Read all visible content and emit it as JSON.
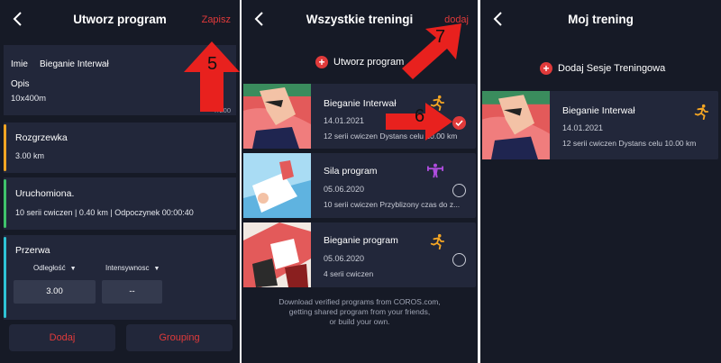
{
  "colors": {
    "accent": "#e03a3a",
    "background": "#161a26",
    "card": "#22273a",
    "warmup": "#f5a623",
    "run": "#3fc36b",
    "rest": "#2ec4d6",
    "strength": "#b04de0",
    "run_icon": "#f5a623"
  },
  "screen1": {
    "title": "Utworz program",
    "save": "Zapisz",
    "name_label": "Imie",
    "name_value": "Bieganie Interwał",
    "desc_label": "Opis",
    "desc_value": "10x400m",
    "char_count": "7/200",
    "segments": [
      {
        "title": "Rozgrzewka",
        "detail": "3.00 km"
      },
      {
        "title": "Uruchomiona.",
        "detail": "10 serii cwiczen | 0.40 km | Odpoczynek 00:00:40"
      },
      {
        "title": "Przerwa",
        "detail": ""
      }
    ],
    "dropdown_distance": "Odległość",
    "dropdown_intensity": "Intensywnosc",
    "distance_value": "3.00",
    "intensity_value": "--",
    "btn_add": "Dodaj",
    "btn_grouping": "Grouping",
    "marker": "5"
  },
  "screen2": {
    "title": "Wszystkie treningi",
    "add": "dodaj",
    "create": "Utworz program",
    "marker_check": "6",
    "marker_add": "7",
    "programs": [
      {
        "name": "Bieganie Interwał",
        "date": "14.01.2021",
        "desc": "12 serii cwiczen Dystans celu 10.00 km",
        "icon": "runner-icon",
        "selected": true
      },
      {
        "name": "Sila program",
        "date": "05.06.2020",
        "desc": "10 serii cwiczen Przyblizony czas do z...",
        "icon": "strength-icon",
        "selected": false
      },
      {
        "name": "Bieganie program",
        "date": "05.06.2020",
        "desc": "4 serii cwiczen",
        "icon": "runner-icon",
        "selected": false
      }
    ],
    "footer": [
      "Download verified programs from COROS.com,",
      "getting shared program from your friends,",
      "or build your own."
    ]
  },
  "screen3": {
    "title": "Moj trening",
    "add_session": "Dodaj Sesje Treningowa",
    "program": {
      "name": "Bieganie Interwał",
      "date": "14.01.2021",
      "desc": "12 serii cwiczen Dystans celu 10.00 km",
      "icon": "runner-icon"
    }
  }
}
